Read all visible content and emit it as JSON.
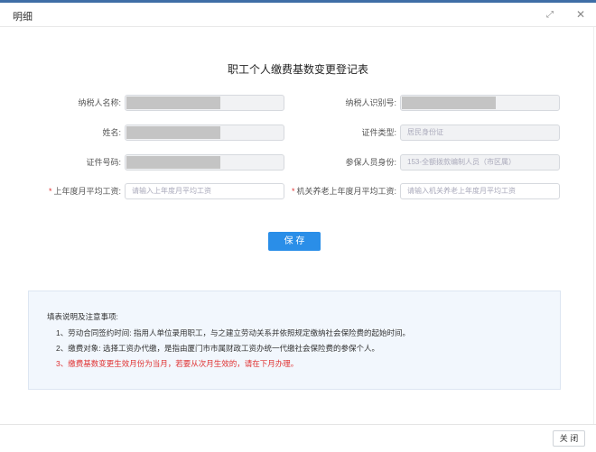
{
  "dialog": {
    "title": "明细",
    "expand_icon": "expand-arrows",
    "close_icon": "close-x"
  },
  "form": {
    "title": "职工个人缴费基数变更登记表",
    "fields": {
      "taxpayer_name": {
        "label": "纳税人名称:",
        "value": ""
      },
      "taxpayer_id": {
        "label": "纳税人识别号:",
        "value": ""
      },
      "name": {
        "label": "姓名:",
        "value": ""
      },
      "id_type": {
        "label": "证件类型:",
        "value": "居民身份证"
      },
      "id_number": {
        "label": "证件号码:",
        "value": ""
      },
      "insured_identity": {
        "label": "参保人员身份:",
        "value": "153-全额拨款编制人员（市区属）"
      },
      "last_year_wage": {
        "label": "上年度月平均工资:",
        "placeholder": "请输入上年度月平均工资",
        "required": "*"
      },
      "pension_last_year_wage": {
        "label": "机关养老上年度月平均工资:",
        "placeholder": "请输入机关养老上年度月平均工资",
        "required": "*"
      }
    },
    "save_label": "保 存"
  },
  "notes": {
    "heading": "填表说明及注意事项:",
    "items": [
      "1、劳动合同签约时间: 指用人单位录用职工，与之建立劳动关系并依照规定缴纳社会保险费的起始时间。",
      "2、缴费对象: 选择工资办代缴，是指由厦门市市属财政工资办统一代缴社会保险费的参保个人。",
      "3、缴费基数变更生效月份为当月，若要从次月生效的，请在下月办理。"
    ]
  },
  "footer": {
    "close_label": "关 闭"
  },
  "colors": {
    "primary": "#2a8ee8",
    "warning": "#e03131",
    "notes_bg": "#f2f7fd"
  }
}
